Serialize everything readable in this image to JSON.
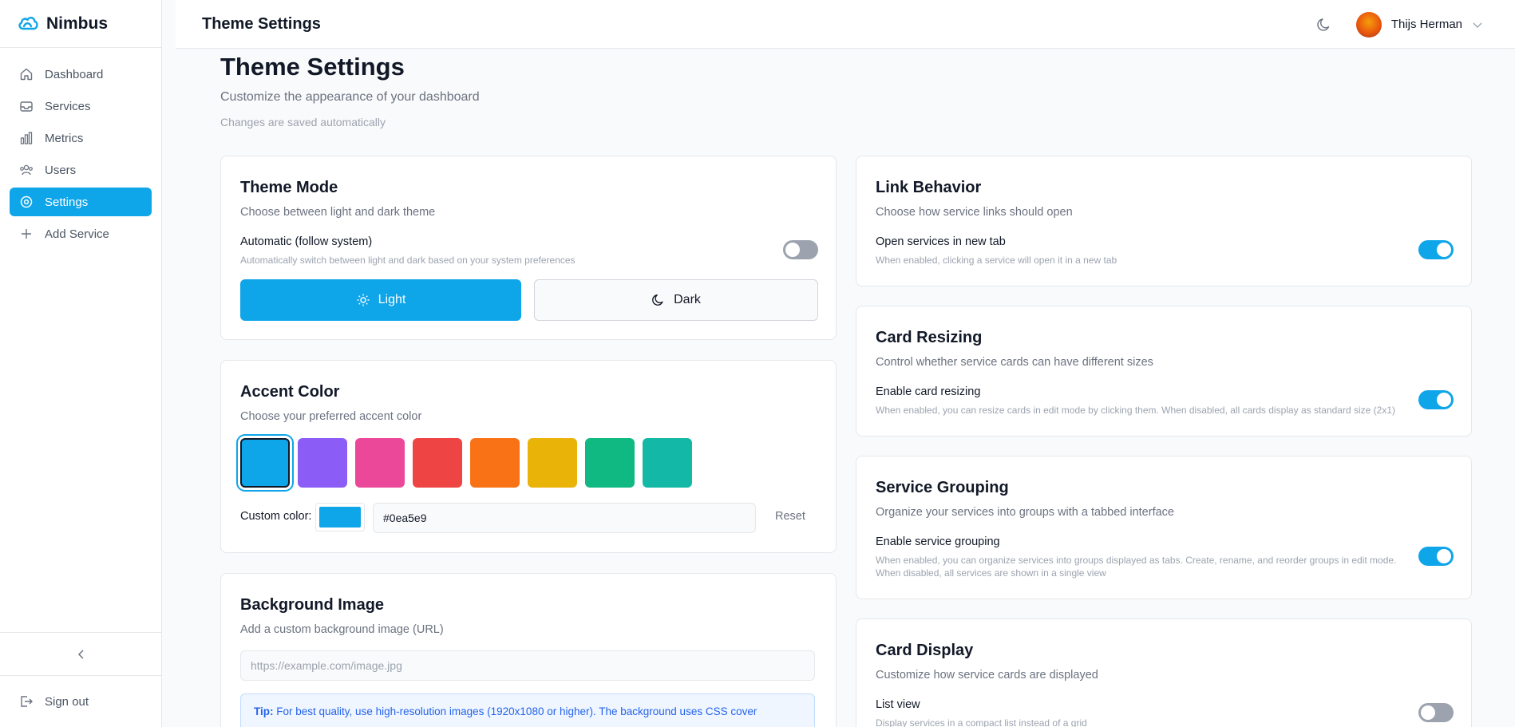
{
  "brand": {
    "name": "Nimbus"
  },
  "sidebar": {
    "items": [
      {
        "label": "Dashboard",
        "icon": "home-icon"
      },
      {
        "label": "Services",
        "icon": "inbox-icon"
      },
      {
        "label": "Metrics",
        "icon": "bar-chart-icon"
      },
      {
        "label": "Users",
        "icon": "users-icon"
      },
      {
        "label": "Settings",
        "icon": "settings-icon",
        "active": true
      },
      {
        "label": "Add Service",
        "icon": "plus-icon"
      }
    ],
    "sign_out": "Sign out"
  },
  "header": {
    "title": "Theme Settings",
    "user_name": "Thijs Herman"
  },
  "page": {
    "title": "Theme Settings",
    "subtitle": "Customize the appearance of your dashboard",
    "note": "Changes are saved automatically"
  },
  "theme_mode": {
    "title": "Theme Mode",
    "desc": "Choose between light and dark theme",
    "auto_label": "Automatic (follow system)",
    "auto_help": "Automatically switch between light and dark based on your system preferences",
    "auto_enabled": false,
    "light_label": "Light",
    "dark_label": "Dark",
    "selected": "Light"
  },
  "accent": {
    "title": "Accent Color",
    "desc": "Choose your preferred accent color",
    "swatches": [
      "#0ea5e9",
      "#8b5cf6",
      "#ec4899",
      "#ef4444",
      "#f97316",
      "#eab308",
      "#10b981",
      "#14b8a6"
    ],
    "selected_index": 0,
    "custom_label": "Custom color:",
    "custom_value": "#0ea5e9",
    "reset_label": "Reset"
  },
  "background": {
    "title": "Background Image",
    "desc": "Add a custom background image (URL)",
    "placeholder": "https://example.com/image.jpg",
    "tip_label": "Tip:",
    "tip_text": "For best quality, use high-resolution images (1920x1080 or higher). The background uses CSS cover"
  },
  "link_behavior": {
    "title": "Link Behavior",
    "desc": "Choose how service links should open",
    "opt_label": "Open services in new tab",
    "opt_help": "When enabled, clicking a service will open it in a new tab",
    "enabled": true
  },
  "card_resizing": {
    "title": "Card Resizing",
    "desc": "Control whether service cards can have different sizes",
    "opt_label": "Enable card resizing",
    "opt_help": "When enabled, you can resize cards in edit mode by clicking them. When disabled, all cards display as standard size (2x1)",
    "enabled": true
  },
  "service_grouping": {
    "title": "Service Grouping",
    "desc": "Organize your services into groups with a tabbed interface",
    "opt_label": "Enable service grouping",
    "opt_help_1": "When enabled, you can organize services into groups displayed as tabs. Create, rename, and reorder groups in edit mode.",
    "opt_help_2": "When disabled, all services are shown in a single view",
    "enabled": true
  },
  "card_display": {
    "title": "Card Display",
    "desc": "Customize how service cards are displayed",
    "opt_label": "List view",
    "opt_help": "Display services in a compact list instead of a grid",
    "enabled": false
  }
}
